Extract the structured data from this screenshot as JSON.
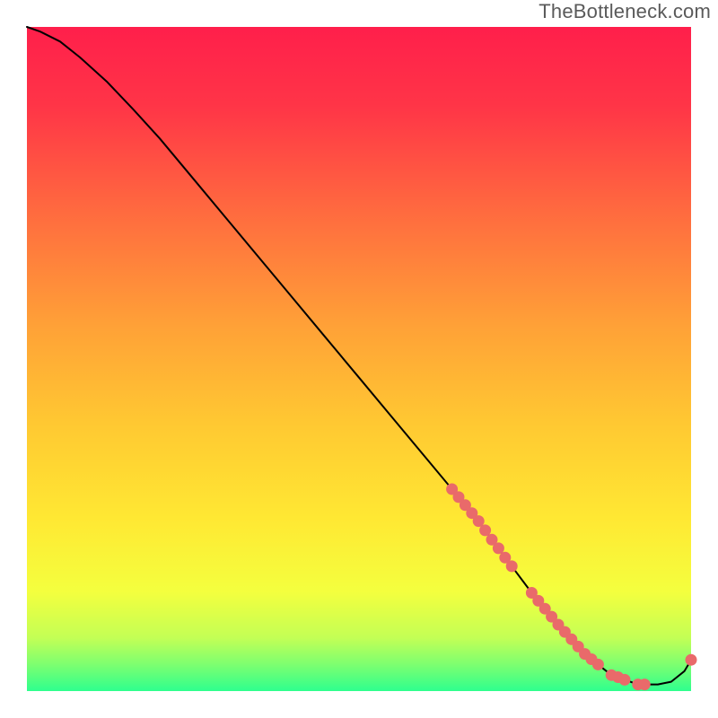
{
  "watermark": "TheBottleneck.com",
  "chart_data": {
    "type": "line",
    "title": "",
    "xlabel": "",
    "ylabel": "",
    "xlim": [
      0,
      100
    ],
    "ylim": [
      0,
      100
    ],
    "grid": false,
    "legend": false,
    "background_gradient": {
      "from": "#ff1f4b",
      "to": "#2eff8e",
      "mid": "#ffd531"
    },
    "series": [
      {
        "name": "bottleneck-curve",
        "color": "#000000",
        "x": [
          0,
          2,
          5,
          8,
          12,
          16,
          20,
          25,
          30,
          35,
          40,
          45,
          50,
          55,
          60,
          65,
          68,
          70,
          73,
          76,
          80,
          84,
          88,
          92,
          95,
          97,
          99,
          100
        ],
        "y": [
          100,
          99.3,
          97.8,
          95.4,
          91.8,
          87.6,
          83.2,
          77.2,
          71.2,
          65.2,
          59.2,
          53.2,
          47.2,
          41.2,
          35.2,
          29.2,
          25.6,
          22.8,
          18.8,
          14.8,
          10.0,
          5.6,
          2.4,
          1.0,
          1.0,
          1.4,
          3.0,
          4.7
        ]
      }
    ],
    "point_cluster": {
      "name": "marker-dots",
      "color": "#e96a6a",
      "x": [
        64,
        65,
        66,
        67,
        68,
        69,
        70,
        71,
        72,
        73,
        76,
        77,
        78,
        79,
        80,
        81,
        82,
        83,
        84,
        85,
        86,
        88,
        89,
        90,
        92,
        93,
        100
      ],
      "y": [
        30.4,
        29.2,
        28.0,
        26.8,
        25.6,
        24.2,
        22.8,
        21.5,
        20.1,
        18.8,
        14.8,
        13.6,
        12.4,
        11.2,
        10.0,
        8.9,
        7.8,
        6.7,
        5.6,
        4.8,
        4.0,
        2.4,
        2.1,
        1.7,
        1.0,
        1.0,
        4.7
      ]
    }
  }
}
